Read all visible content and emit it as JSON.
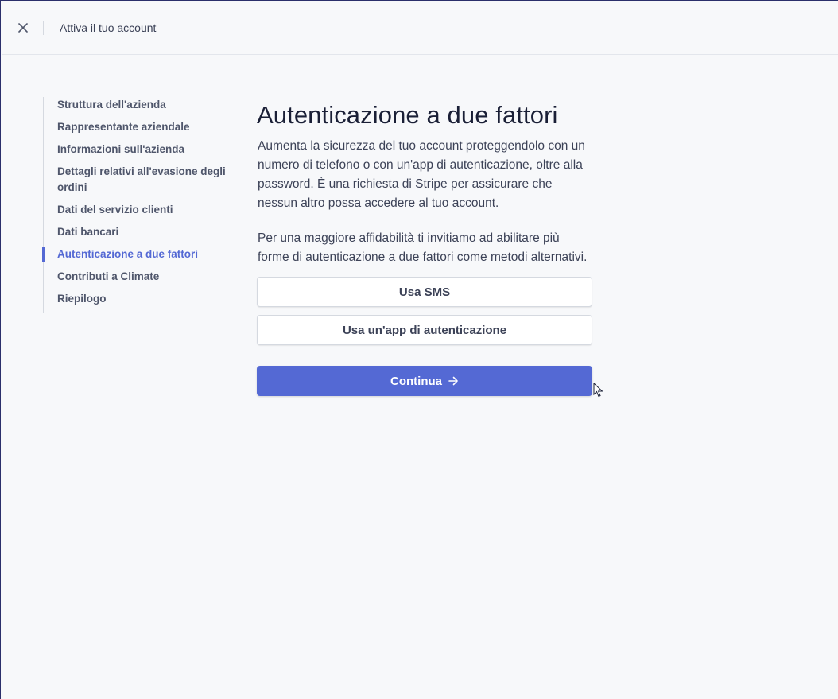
{
  "topbar": {
    "title": "Attiva il tuo account",
    "close_icon": "close-icon"
  },
  "sidebar": {
    "items": [
      {
        "label": "Struttura dell'azienda",
        "active": false
      },
      {
        "label": "Rappresentante aziendale",
        "active": false
      },
      {
        "label": "Informazioni sull'azienda",
        "active": false
      },
      {
        "label": "Dettagli relativi all'evasione degli ordini",
        "active": false
      },
      {
        "label": "Dati del servizio clienti",
        "active": false
      },
      {
        "label": "Dati bancari",
        "active": false
      },
      {
        "label": "Autenticazione a due fattori",
        "active": true
      },
      {
        "label": "Contributi a Climate",
        "active": false
      },
      {
        "label": "Riepilogo",
        "active": false
      }
    ]
  },
  "main": {
    "title": "Autenticazione a due fattori",
    "description": "Aumenta la sicurezza del tuo account proteggendolo con un numero di telefono o con un'app di autenticazione, oltre alla password. È una richiesta di Stripe per assicurare che nessun altro possa accedere al tuo account.",
    "note": "Per una maggiore affidabilità ti invitiamo ad abilitare più forme di autenticazione a due fattori come metodi alternativi.",
    "option_sms": "Usa SMS",
    "option_app": "Usa un'app di autenticazione",
    "continue_label": "Continua"
  },
  "colors": {
    "accent": "#5469d4",
    "background": "#f7f8fa",
    "text": "#3c4257",
    "heading": "#1a1f36"
  }
}
